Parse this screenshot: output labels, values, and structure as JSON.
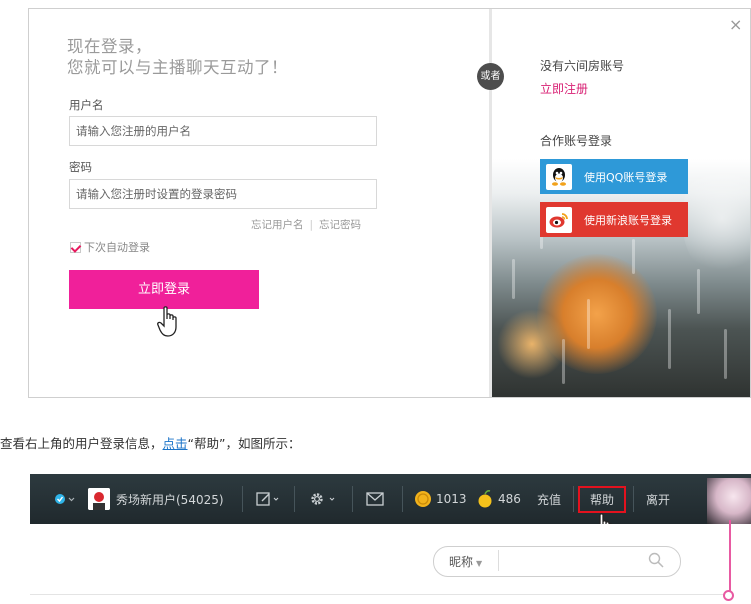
{
  "login": {
    "title_line1": "现在登录，",
    "title_line2": "您就可以与主播聊天互动了！",
    "username_label": "用户名",
    "username_placeholder": "请输入您注册的用户名",
    "password_label": "密码",
    "password_placeholder": "请输入您注册时设置的登录密码",
    "forgot_username": "忘记用户名",
    "forgot_separator": "|",
    "forgot_password": "忘记密码",
    "auto_login": "下次自动登录",
    "auto_login_checked": true,
    "login_button": "立即登录",
    "or_badge": "或者",
    "close": "×"
  },
  "register": {
    "no_account": "没有六间房账号",
    "register_link": "立即注册",
    "partner_login": "合作账号登录",
    "qq_button": "使用QQ账号登录",
    "weibo_button": "使用新浪账号登录"
  },
  "tutorial": {
    "text_before": "查看右上角的用户登录信息，",
    "link": "点击",
    "text_after": "“帮助”，如图所示："
  },
  "topbar": {
    "username": "秀场新用户(54025)",
    "coins": "1013",
    "beans": "486",
    "recharge": "充值",
    "help": "帮助",
    "leave": "离开",
    "status_color": "#2fb4e8",
    "highlight_color": "#e3121e"
  },
  "search": {
    "nickname_select": "昵称",
    "placeholder": ""
  },
  "colors": {
    "login_button": "#f0209a",
    "register_link": "#d81f73",
    "qq": "#2e99d8",
    "weibo": "#e0382f",
    "topbar": "#2d3a3f"
  }
}
